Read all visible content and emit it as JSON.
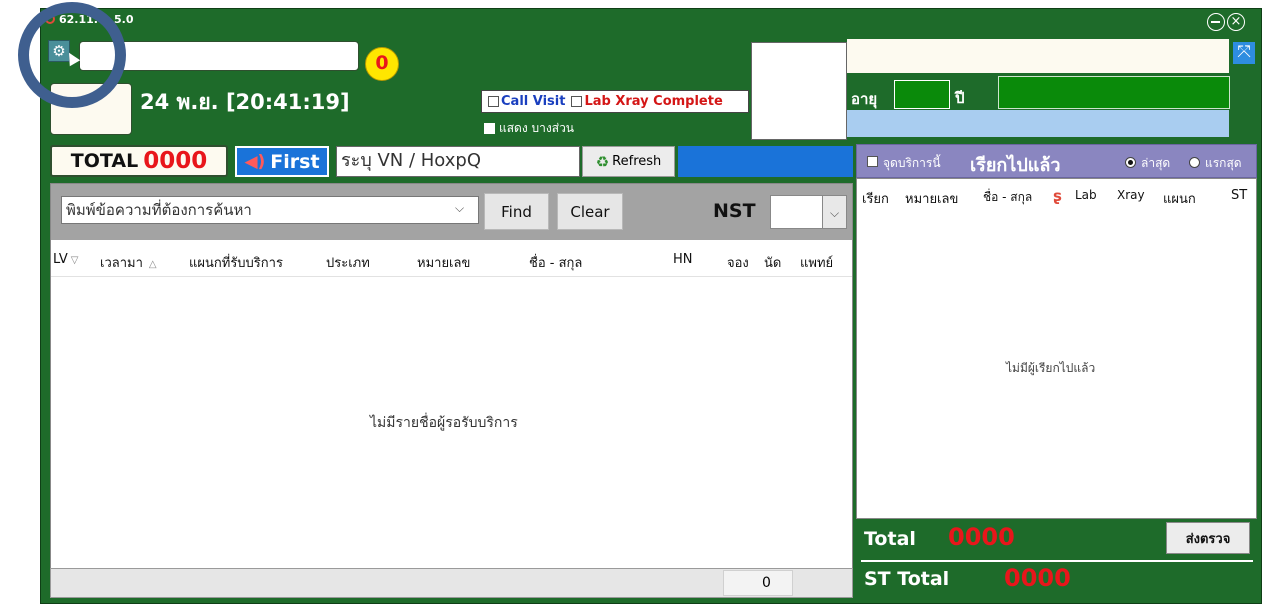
{
  "window": {
    "title": "62.11.",
    "title_suffix": "5.0",
    "minimize_icon": "minus-circle-icon",
    "close_icon": "close-circle-icon"
  },
  "header": {
    "counter_badge": "0",
    "date_time": "24 พ.ย. [20:41:19]",
    "call_visit_label": "Call Visit",
    "lab_xray_label": "Lab Xray Complete",
    "show_partial_label": "แสดง บางส่วน",
    "age_label": "อายุ",
    "year_label": "ปี",
    "age_value": ""
  },
  "toolbar": {
    "total_label": "TOTAL",
    "total_value": "0000",
    "first_label": "First",
    "vn_placeholder": "ระบุ VN / HoxpQ",
    "refresh_label": "Refresh"
  },
  "search": {
    "placeholder": "พิมพ์ข้อความที่ต้องการค้นหา",
    "find_label": "Find",
    "clear_label": "Clear",
    "nst_label": "NST"
  },
  "queue_table": {
    "columns": [
      "LV",
      "เวลามา",
      "แผนกที่รับบริการ",
      "ประเภท",
      "หมายเลข",
      "ชื่อ - สกุล",
      "HN",
      "จอง",
      "นัด",
      "แพทย์"
    ],
    "empty_message": "ไม่มีรายชื่อผู้รอรับบริการ",
    "footer_count": "0"
  },
  "called_panel": {
    "service_point_label": "จุดบริการนี้",
    "title": "เรียกไปแล้ว",
    "radio_latest": "ล่าสุด",
    "radio_first": "แรกสุด",
    "columns": [
      "เรียก",
      "หมายเลข",
      "ชื่อ - สกุล",
      "Lab",
      "Xray",
      "แผนก",
      "ST"
    ],
    "empty_message": "ไม่มีผู้เรียกไปแล้ว",
    "total_label": "Total",
    "total_value": "0000",
    "send_button": "ส่งตรวจ",
    "st_total_label": "ST Total",
    "st_total_value": "0000"
  },
  "colors": {
    "window_green": "#1e6b2a",
    "panel_blue": "#1a73d9",
    "badge_yellow": "#ffe600",
    "total_red": "#e8161b",
    "light_blue_bar": "#a9cdf0",
    "bright_green_field": "#0a8a0a"
  }
}
